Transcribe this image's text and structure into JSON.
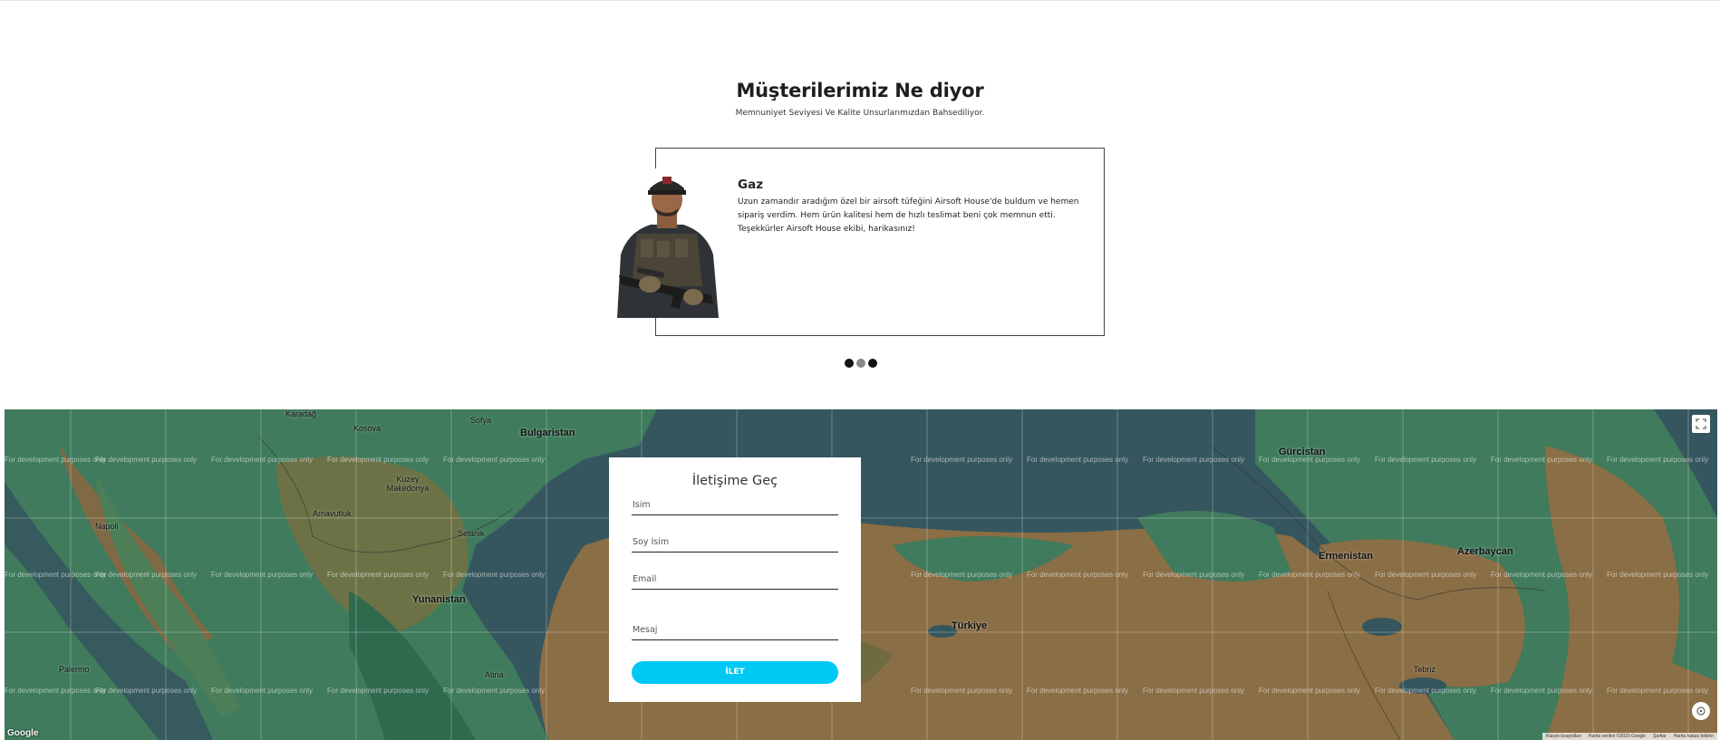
{
  "testimonials": {
    "heading": "Müşterilerimiz Ne diyor",
    "subheading": "Memnuniyet Seviyesi Ve Kalite Unsurlarımızdan Bahsediliyor.",
    "current": {
      "name": "Gaz",
      "text": "Uzun zamandır aradığım özel bir airsoft tüfeğini Airsoft House'de buldum ve hemen sipariş verdim. Hem ürün kalitesi hem de hızlı teslimat beni çok memnun etti. Teşekkürler Airsoft House ekibi, harikasınız!"
    },
    "slide_count": 3,
    "active_slide": 2
  },
  "map": {
    "watermark": "For development purposes only",
    "labels": [
      "Karadağ",
      "Kosova",
      "Bulgaristan",
      "Sofya",
      "Kuzey Makedonya",
      "Arnavutluk",
      "Selanik",
      "Yunanistan",
      "Gürcistan",
      "Ermenistan",
      "Azerbaycan",
      "Türkiye",
      "Tebriz",
      "Napoli",
      "Palermo",
      "Atina"
    ],
    "google_logo": "Google",
    "attribution": [
      "Klavye kısayolları",
      "Harita verileri ©2023 Google",
      "Şartlar",
      "Harita hatası bildirin"
    ]
  },
  "contact_form": {
    "title": "İletişime Geç",
    "first_name_placeholder": "İsim",
    "last_name_placeholder": "Soy İsim",
    "email_placeholder": "Email",
    "message_placeholder": "Mesaj",
    "submit_label": "İLET"
  },
  "colors": {
    "accent": "#00c8f4",
    "map_sea": "#35565e",
    "map_land_green": "#3f7b5c",
    "map_land_brown": "#8a6e45"
  }
}
